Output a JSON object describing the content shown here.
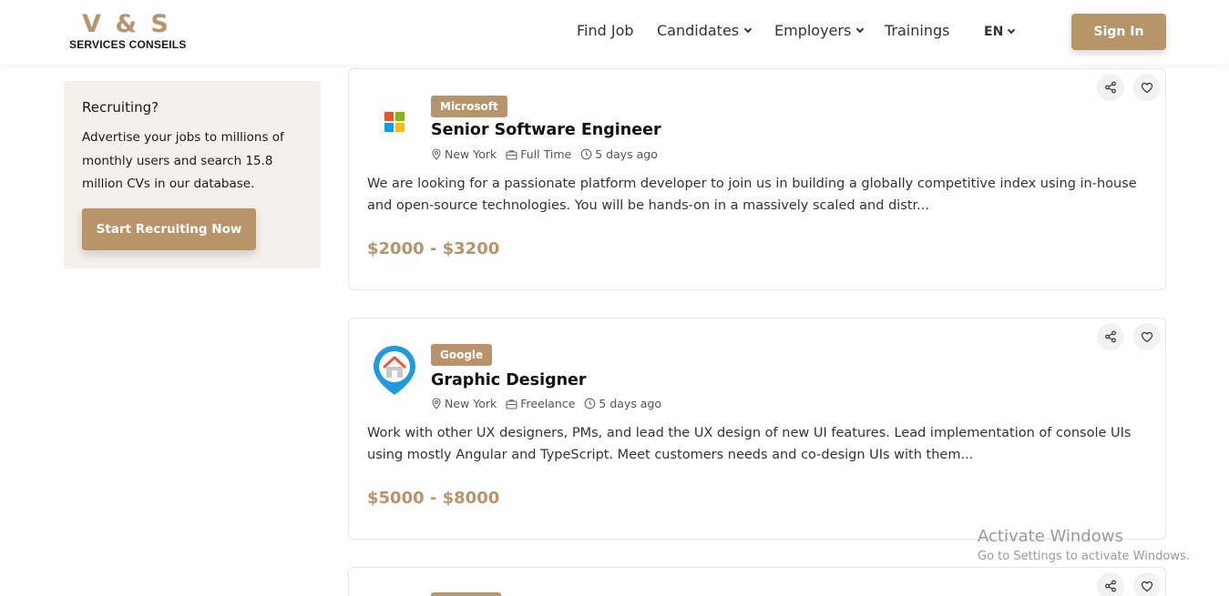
{
  "brand": {
    "mark": "V & S",
    "subtitle": "SERVICES CONSEILS",
    "accent": "#b8946a"
  },
  "nav": {
    "find_job": "Find Job",
    "candidates": "Candidates",
    "employers": "Employers",
    "trainings": "Trainings",
    "language": "EN",
    "sign_in": "Sign In"
  },
  "sidebar": {
    "title": "Recruiting?",
    "text": "Advertise your jobs to millions of monthly users and search 15.8 million CVs in our database.",
    "button": "Start Recruiting Now"
  },
  "jobs": [
    {
      "company": "Microsoft",
      "logo_icon": "microsoft-logo",
      "title": "Senior Software Engineer",
      "location": "New York",
      "type": "Full Time",
      "posted": "5 days ago",
      "description": "We are looking for a passionate platform developer to join us in building a globally competitive index using in-house and open-source technologies. You will be hands-on in a massively scaled and distr...",
      "salary": "$2000 - $3200"
    },
    {
      "company": "Google",
      "logo_icon": "home-pin-logo",
      "title": "Graphic Designer",
      "location": "New York",
      "type": "Freelance",
      "posted": "5 days ago",
      "description": "Work with other UX designers, PMs, and lead the UX design of new UI features. Lead implementation of console UIs using mostly Angular and TypeScript. Meet customers needs and co-design UIs with them...",
      "salary": "$5000 - $8000"
    }
  ],
  "watermark": {
    "title": "Activate Windows",
    "subtitle": "Go to Settings to activate Windows."
  }
}
